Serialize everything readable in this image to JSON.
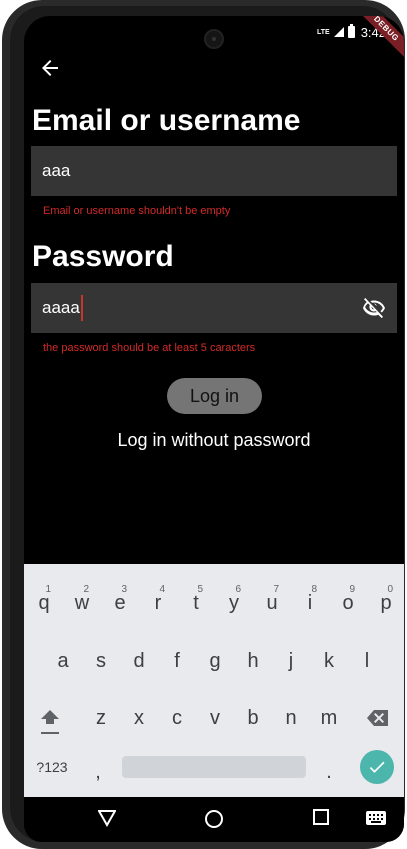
{
  "status_bar": {
    "network": "LTE",
    "time": "3:42"
  },
  "debug_banner": "DEBUG",
  "email": {
    "label": "Email or username",
    "value": "aaa",
    "error": "Email or username shouldn't be empty"
  },
  "password": {
    "label": "Password",
    "value": "aaaa",
    "error": "the password should be at least 5 caracters"
  },
  "buttons": {
    "login": "Log in",
    "login_without_password": "Log in without password"
  },
  "keyboard": {
    "row1": [
      {
        "key": "q",
        "hint": "1"
      },
      {
        "key": "w",
        "hint": "2"
      },
      {
        "key": "e",
        "hint": "3"
      },
      {
        "key": "r",
        "hint": "4"
      },
      {
        "key": "t",
        "hint": "5"
      },
      {
        "key": "y",
        "hint": "6"
      },
      {
        "key": "u",
        "hint": "7"
      },
      {
        "key": "i",
        "hint": "8"
      },
      {
        "key": "o",
        "hint": "9"
      },
      {
        "key": "p",
        "hint": "0"
      }
    ],
    "row2": [
      "a",
      "s",
      "d",
      "f",
      "g",
      "h",
      "j",
      "k",
      "l"
    ],
    "row3": [
      "z",
      "x",
      "c",
      "v",
      "b",
      "n",
      "m"
    ],
    "symbols": "?123",
    "comma": ",",
    "period": "."
  },
  "colors": {
    "background": "#000000",
    "input_fill": "#353535",
    "error": "#d22a2a",
    "button_fill": "#757575",
    "keyboard_bg": "#e8eaed",
    "enter_key": "#4db6ac"
  }
}
